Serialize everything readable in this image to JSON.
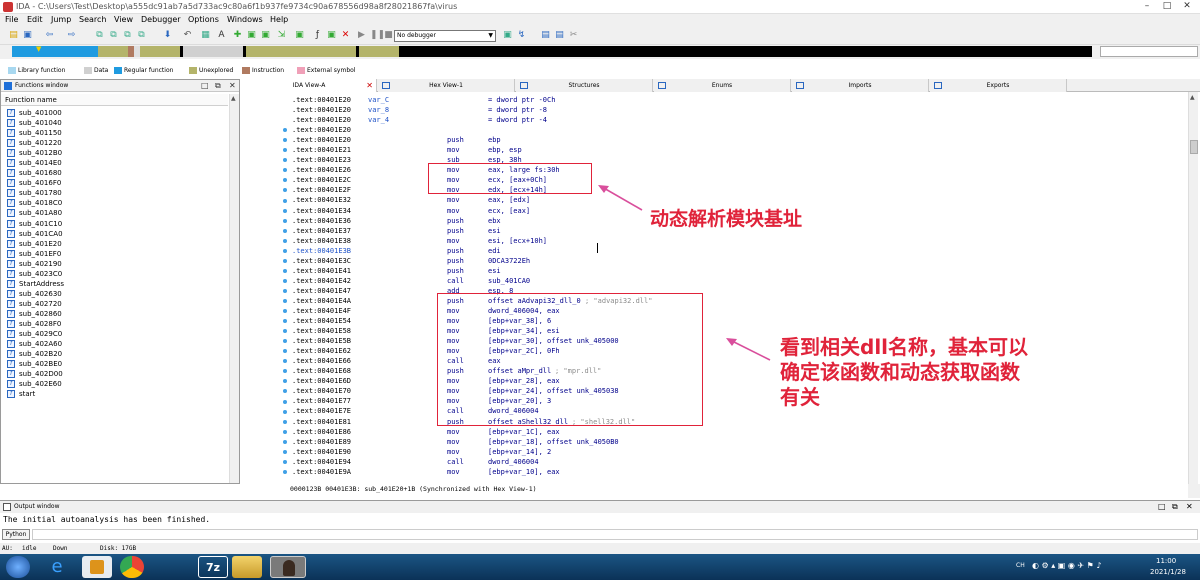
{
  "window": {
    "title": "IDA - C:\\Users\\Test\\Desktop\\a555dc91ab7a5d733ac9c80a6f1b937fe9734c90a678556d98a8f28021867fa\\virus"
  },
  "menu": [
    "File",
    "Edit",
    "Jump",
    "Search",
    "View",
    "Debugger",
    "Options",
    "Windows",
    "Help"
  ],
  "toolbar": {
    "debugger": "No debugger"
  },
  "legend": [
    {
      "label": "Library function",
      "color": "#a8d8f0"
    },
    {
      "label": "Data",
      "color": "#d0d0d0"
    },
    {
      "label": "Regular function",
      "color": "#1f9be0"
    },
    {
      "label": "Unexplored",
      "color": "#b4b46a"
    },
    {
      "label": "Instruction",
      "color": "#b07a60"
    },
    {
      "label": "External symbol",
      "color": "#f0a0b8"
    }
  ],
  "functions_panel": {
    "title": "Functions window",
    "column": "Function name",
    "items": [
      "sub_401000",
      "sub_401040",
      "sub_401150",
      "sub_401220",
      "sub_4012B0",
      "sub_4014E0",
      "sub_401680",
      "sub_4016F0",
      "sub_401780",
      "sub_4018C0",
      "sub_401A80",
      "sub_401C10",
      "sub_401CA0",
      "sub_401E20",
      "sub_401EF0",
      "sub_402190",
      "sub_4023C0",
      "StartAddress",
      "sub_402630",
      "sub_402720",
      "sub_402860",
      "sub_4028F0",
      "sub_4029C0",
      "sub_402A60",
      "sub_402B20",
      "sub_402BE0",
      "sub_402D00",
      "sub_402E60",
      "start"
    ]
  },
  "tabs": [
    "IDA View-A",
    "Hex View-1",
    "Structures",
    "Enums",
    "Imports",
    "Exports"
  ],
  "code": [
    {
      "addr": ".text:00401E20",
      "label": "var_C",
      "mn": "",
      "op": "= dword ptr -0Ch",
      "cm": ""
    },
    {
      "addr": ".text:00401E20",
      "label": "var_8",
      "mn": "",
      "op": "= dword ptr -8",
      "cm": ""
    },
    {
      "addr": ".text:00401E20",
      "label": "var_4",
      "mn": "",
      "op": "= dword ptr -4",
      "cm": ""
    },
    {
      "addr": ".text:00401E20",
      "label": "",
      "mn": "",
      "op": "",
      "cm": ""
    },
    {
      "addr": ".text:00401E20",
      "label": "",
      "mn": "push",
      "op": "ebp",
      "cm": ""
    },
    {
      "addr": ".text:00401E21",
      "label": "",
      "mn": "mov",
      "op": "ebp, esp",
      "cm": ""
    },
    {
      "addr": ".text:00401E23",
      "label": "",
      "mn": "sub",
      "op": "esp, 38h",
      "cm": ""
    },
    {
      "addr": ".text:00401E26",
      "label": "",
      "mn": "mov",
      "op": "eax, large fs:30h",
      "cm": ""
    },
    {
      "addr": ".text:00401E2C",
      "label": "",
      "mn": "mov",
      "op": "ecx, [eax+0Ch]",
      "cm": ""
    },
    {
      "addr": ".text:00401E2F",
      "label": "",
      "mn": "mov",
      "op": "edx, [ecx+14h]",
      "cm": ""
    },
    {
      "addr": ".text:00401E32",
      "label": "",
      "mn": "mov",
      "op": "eax, [edx]",
      "cm": ""
    },
    {
      "addr": ".text:00401E34",
      "label": "",
      "mn": "mov",
      "op": "ecx, [eax]",
      "cm": ""
    },
    {
      "addr": ".text:00401E36",
      "label": "",
      "mn": "push",
      "op": "ebx",
      "cm": ""
    },
    {
      "addr": ".text:00401E37",
      "label": "",
      "mn": "push",
      "op": "esi",
      "cm": ""
    },
    {
      "addr": ".text:00401E38",
      "label": "",
      "mn": "mov",
      "op": "esi, [ecx+10h]",
      "cm": ""
    },
    {
      "addr": ".text:00401E3B",
      "label": "",
      "mn": "push",
      "op": "edi",
      "cm": "",
      "current": true
    },
    {
      "addr": ".text:00401E3C",
      "label": "",
      "mn": "push",
      "op": "0DCA3722Eh",
      "cm": ""
    },
    {
      "addr": ".text:00401E41",
      "label": "",
      "mn": "push",
      "op": "esi",
      "cm": ""
    },
    {
      "addr": ".text:00401E42",
      "label": "",
      "mn": "call",
      "op": "sub_401CA0",
      "cm": ""
    },
    {
      "addr": ".text:00401E47",
      "label": "",
      "mn": "add",
      "op": "esp, 8",
      "cm": ""
    },
    {
      "addr": ".text:00401E4A",
      "label": "",
      "mn": "push",
      "op": "offset aAdvapi32_dll_0",
      "cm": "; \"advapi32.dll\""
    },
    {
      "addr": ".text:00401E4F",
      "label": "",
      "mn": "mov",
      "op": "dword_406004, eax",
      "cm": ""
    },
    {
      "addr": ".text:00401E54",
      "label": "",
      "mn": "mov",
      "op": "[ebp+var_38], 6",
      "cm": ""
    },
    {
      "addr": ".text:00401E58",
      "label": "",
      "mn": "mov",
      "op": "[ebp+var_34], esi",
      "cm": ""
    },
    {
      "addr": ".text:00401E5B",
      "label": "",
      "mn": "mov",
      "op": "[ebp+var_30], offset unk_405000",
      "cm": ""
    },
    {
      "addr": ".text:00401E62",
      "label": "",
      "mn": "mov",
      "op": "[ebp+var_2C], 0Fh",
      "cm": ""
    },
    {
      "addr": ".text:00401E66",
      "label": "",
      "mn": "call",
      "op": "eax",
      "cm": ""
    },
    {
      "addr": ".text:00401E68",
      "label": "",
      "mn": "push",
      "op": "offset aMpr_dll",
      "cm": "; \"mpr.dll\""
    },
    {
      "addr": ".text:00401E6D",
      "label": "",
      "mn": "mov",
      "op": "[ebp+var_28], eax",
      "cm": ""
    },
    {
      "addr": ".text:00401E70",
      "label": "",
      "mn": "mov",
      "op": "[ebp+var_24], offset unk_405038",
      "cm": ""
    },
    {
      "addr": ".text:00401E77",
      "label": "",
      "mn": "mov",
      "op": "[ebp+var_20], 3",
      "cm": ""
    },
    {
      "addr": ".text:00401E7E",
      "label": "",
      "mn": "call",
      "op": "dword_406004",
      "cm": ""
    },
    {
      "addr": ".text:00401E81",
      "label": "",
      "mn": "push",
      "op": "offset aShell32_dll",
      "cm": "; \"shell32.dll\""
    },
    {
      "addr": ".text:00401E86",
      "label": "",
      "mn": "mov",
      "op": "[ebp+var_1C], eax",
      "cm": ""
    },
    {
      "addr": ".text:00401E89",
      "label": "",
      "mn": "mov",
      "op": "[ebp+var_18], offset unk_4050B0",
      "cm": ""
    },
    {
      "addr": ".text:00401E90",
      "label": "",
      "mn": "mov",
      "op": "[ebp+var_14], 2",
      "cm": ""
    },
    {
      "addr": ".text:00401E94",
      "label": "",
      "mn": "call",
      "op": "dword_406004",
      "cm": ""
    },
    {
      "addr": ".text:00401E9A",
      "label": "",
      "mn": "mov",
      "op": "[ebp+var_10], eax",
      "cm": ""
    }
  ],
  "annotations": {
    "a1": "动态解析模块基址",
    "a2_line1": "看到相关dll名称，基本可以",
    "a2_line2": "确定该函数和动态获取函数",
    "a2_line3": "有关"
  },
  "status_line": "0000123B 00401E3B: sub_401E20+1B (Synchronized with Hex View-1)",
  "output": {
    "title": "Output window",
    "text": "The initial autoanalysis has been finished.",
    "python": "Python"
  },
  "statusbar": {
    "au": "AU:",
    "au_state": "idle",
    "direction": "Down",
    "disk": "Disk: 17GB"
  },
  "taskbar": {
    "time": "11:00",
    "date": "2021/1/28",
    "lang": "CH"
  },
  "colors": {
    "accent": "#1f52c7",
    "annotation": "#e0233a",
    "arrow": "#d94f9c"
  }
}
